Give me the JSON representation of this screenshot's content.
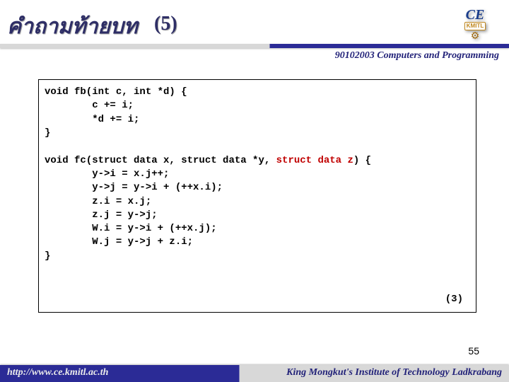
{
  "header": {
    "title_thai": "คำถามท้ายบท",
    "title_num": "(5)",
    "course": "90102003 Computers and Programming",
    "logo": {
      "top": "CE",
      "sub": "KMITL",
      "gear": "⚙"
    }
  },
  "code": {
    "fb": {
      "l1": "void fb(int c, int *d) {",
      "l2": "        c += i;",
      "l3": "        *d += i;",
      "l4": "}"
    },
    "fc": {
      "l1a": "void fc(struct data x, struct data *y, ",
      "l1b": "struct data z",
      "l1c": ") {",
      "l2": "        y->i = x.j++;",
      "l3": "        y->j = y->i + (++x.i);",
      "l4": "        z.i = x.j;",
      "l5": "        z.j = y->j;",
      "l6": "        W.i = y->i + (++x.j);",
      "l7": "        W.j = y->j + z.i;",
      "l8": "}"
    },
    "page_mark": "(3)"
  },
  "pageno": "55",
  "footer": {
    "url": "http://www.ce.kmitl.ac.th",
    "inst": "King Mongkut's Institute of Technology Ladkrabang"
  }
}
